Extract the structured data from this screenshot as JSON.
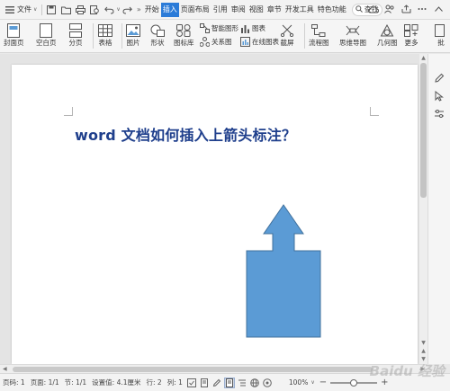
{
  "menubar": {
    "file_label": "文件",
    "tabs": [
      {
        "label": "开始",
        "active": false
      },
      {
        "label": "插入",
        "active": true
      },
      {
        "label": "页面布局",
        "active": false
      },
      {
        "label": "引用",
        "active": false
      },
      {
        "label": "审阅",
        "active": false
      },
      {
        "label": "视图",
        "active": false
      },
      {
        "label": "章节",
        "active": false
      },
      {
        "label": "开发工具",
        "active": false
      },
      {
        "label": "特色功能",
        "active": false
      }
    ],
    "search_label": "查找"
  },
  "ribbon": {
    "cover_page": "封面页",
    "blank_page": "空白页",
    "page_break": "分页",
    "table": "表格",
    "picture": "图片",
    "shape": "形状",
    "icon_library": "图标库",
    "smart_graphic": "智能图形",
    "chart": "图表",
    "relation_graph": "关系图",
    "online_chart": "在线图表",
    "screenshot": "截屏",
    "flowchart": "流程图",
    "mindmap": "思维导图",
    "geometry": "几何图",
    "more": "更多",
    "batch": "批"
  },
  "document": {
    "title": "word 文档如何插入上箭头标注？"
  },
  "shape": {
    "type": "up-arrow-callout",
    "fill": "#5b9bd5",
    "stroke": "#41719c"
  },
  "statusbar": {
    "page_number": "页码: 1",
    "page": "页面: 1/1",
    "section": "节: 1/1",
    "setting": "设置值: 4.1厘米",
    "row": "行: 2",
    "column": "列: 1",
    "zoom": "100%",
    "zoom_fraction": 0.5
  },
  "watermark": "Baidu 经验",
  "colors": {
    "accent": "#2b7bd8",
    "title": "#1f3f8c"
  }
}
